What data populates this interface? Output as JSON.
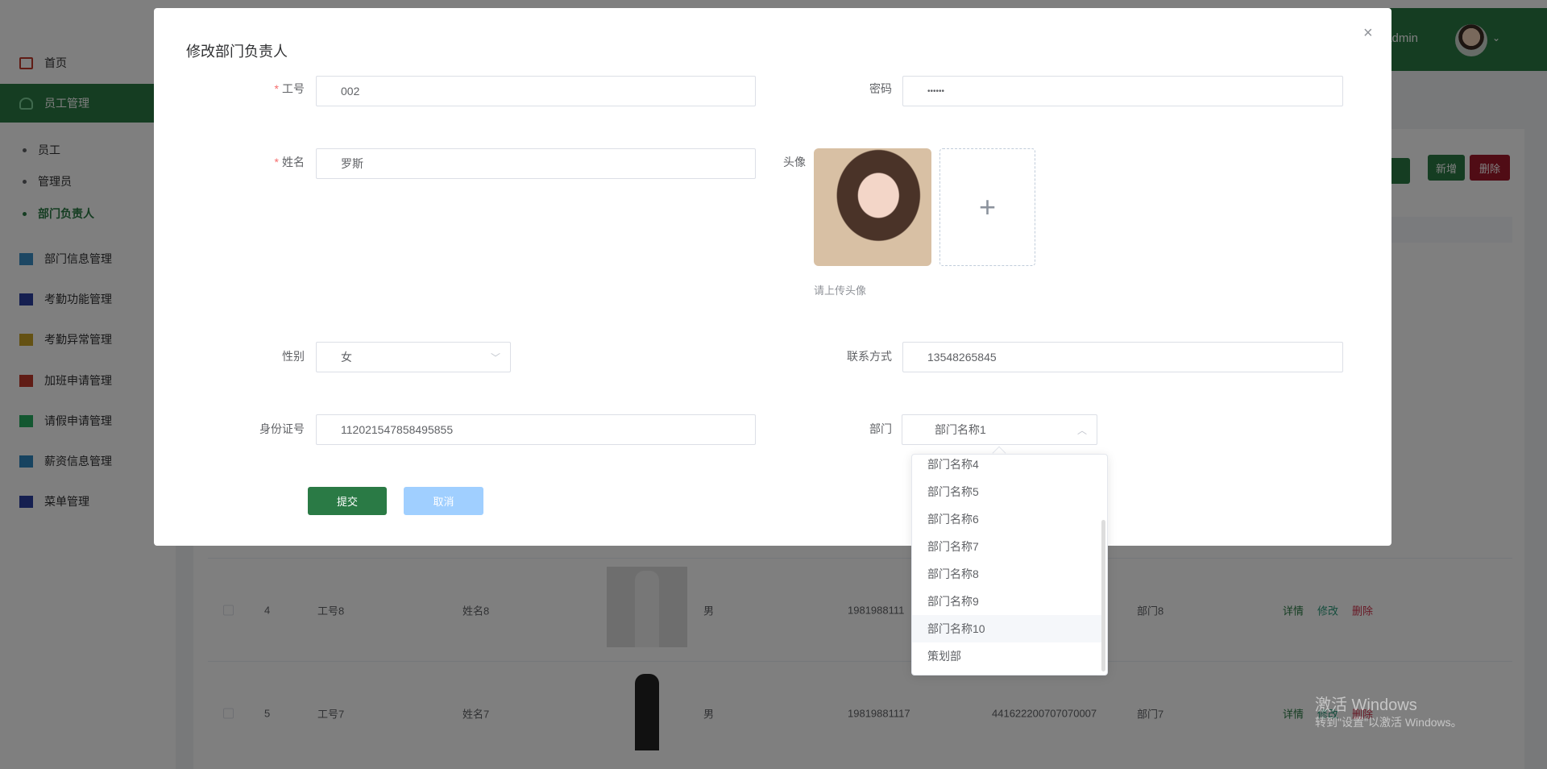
{
  "header": {
    "welcome": "欢迎 admin",
    "avatar_icon": "user-avatar",
    "chevron": "⌄"
  },
  "sidebar": {
    "items": [
      {
        "label": "首页",
        "icon": "home-icon",
        "color": "#c0392b"
      },
      {
        "label": "员工管理",
        "icon": "user-icon",
        "color": "#7fd39b",
        "active": true
      },
      {
        "label": "部门信息管理",
        "icon": "building-icon",
        "color": "#3a8fc7"
      },
      {
        "label": "考勤功能管理",
        "icon": "crop-icon",
        "color": "#2a3fa0"
      },
      {
        "label": "考勤异常管理",
        "icon": "card-icon",
        "color": "#c9a227"
      },
      {
        "label": "加班申请管理",
        "icon": "copy-icon",
        "color": "#c0392b"
      },
      {
        "label": "请假申请管理",
        "icon": "book-icon",
        "color": "#27ae60"
      },
      {
        "label": "薪资信息管理",
        "icon": "wallet-icon",
        "color": "#2e86c1"
      },
      {
        "label": "菜单管理",
        "icon": "grid-icon",
        "color": "#2a3fa0"
      }
    ],
    "sub": [
      "员工",
      "管理员",
      "部门负责人"
    ],
    "current_sub": "部门负责人"
  },
  "toolbar": {
    "add": "新增",
    "delete": "删除"
  },
  "table": {
    "rows": [
      {
        "index": "4",
        "no": "工号8",
        "name": "姓名8",
        "gender": "男",
        "phone": "1981988111",
        "id": "",
        "dept": "部门8"
      },
      {
        "index": "5",
        "no": "工号7",
        "name": "姓名7",
        "gender": "男",
        "phone": "19819881117",
        "id": "441622200707070007",
        "dept": "部门7"
      }
    ],
    "actions": {
      "detail": "详情",
      "edit": "修改",
      "delete": "删除"
    }
  },
  "modal": {
    "title": "修改部门负责人",
    "close": "×",
    "fields": {
      "no": {
        "label": "工号",
        "value": "002",
        "required": true
      },
      "password": {
        "label": "密码",
        "value": "••••••"
      },
      "name": {
        "label": "姓名",
        "value": "罗斯",
        "required": true
      },
      "avatar": {
        "label": "头像",
        "hint": "请上传头像",
        "plus": "+"
      },
      "gender": {
        "label": "性别",
        "value": "女"
      },
      "contact": {
        "label": "联系方式",
        "value": "13548265845"
      },
      "idcard": {
        "label": "身份证号",
        "value": "112021547858495855"
      },
      "dept": {
        "label": "部门",
        "value": "部门名称1"
      }
    },
    "submit": "提交",
    "cancel": "取消",
    "dept_options": [
      "部门名称4",
      "部门名称5",
      "部门名称6",
      "部门名称7",
      "部门名称8",
      "部门名称9",
      "部门名称10",
      "策划部"
    ],
    "hovered_option": "部门名称10"
  },
  "watermark": {
    "line1": "激活 Windows",
    "line2": "转到\"设置\"以激活 Windows。"
  },
  "colors": {
    "primary": "#2a7a45",
    "danger": "#a0182a",
    "cancel": "#a0cfff"
  }
}
